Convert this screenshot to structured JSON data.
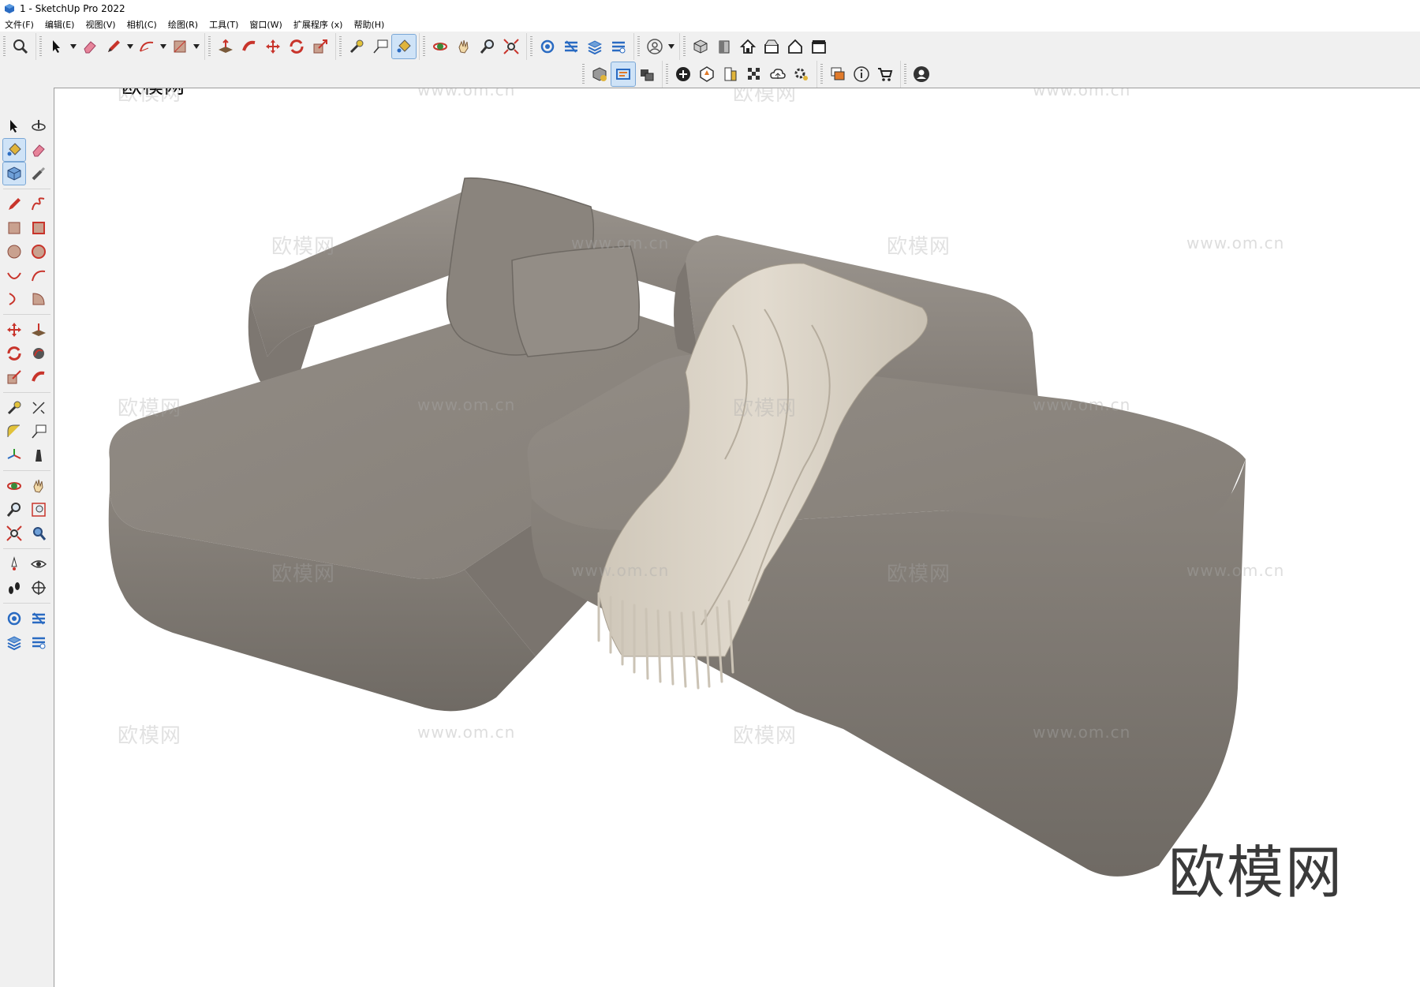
{
  "window": {
    "title": "1 - SketchUp Pro 2022",
    "app_icon": "sketchup-icon"
  },
  "menubar": {
    "items": [
      "文件(F)",
      "编辑(E)",
      "视图(V)",
      "相机(C)",
      "绘图(R)",
      "工具(T)",
      "窗口(W)",
      "扩展程序 (x)",
      "帮助(H)"
    ]
  },
  "toolbar_top": {
    "tools": [
      "zoom-icon",
      "select-icon",
      "eraser-icon",
      "pencil-icon",
      "arc-icon",
      "rectangle-icon",
      "push-pull-icon",
      "follow-me-icon",
      "move-icon",
      "rotate-icon",
      "scale-icon",
      "tape-measure-icon",
      "text-icon",
      "paint-bucket-icon",
      "orbit-icon",
      "pan-icon",
      "zoom-icon",
      "zoom-extents-icon",
      "warehouse-icon",
      "extension-icon",
      "layers-icon",
      "tags-icon",
      "user-icon",
      "iso-view-icon",
      "front-view-icon",
      "home-view-icon",
      "top-view-icon",
      "house-view-icon",
      "store-icon"
    ]
  },
  "toolbar_second": {
    "tools": [
      "solid-tools-icon",
      "outliner-icon",
      "scene-icon",
      "add-icon",
      "location-icon",
      "style-icon",
      "texture-icon",
      "cloud-icon",
      "settings-icon",
      "components-icon",
      "info-icon",
      "cart-icon",
      "account-icon"
    ]
  },
  "left_toolbar": {
    "tools": [
      "select-icon",
      "orbit-icon",
      "paint-bucket-icon",
      "eraser-icon",
      "component-icon",
      "tape-icon",
      "line-icon",
      "freehand-icon",
      "rectangle-icon",
      "rotated-rectangle-icon",
      "circle-icon",
      "polygon-icon",
      "arc-icon",
      "arc-2pt-icon",
      "arc-3pt-icon",
      "pie-icon",
      "move-icon",
      "push-pull-icon",
      "rotate-icon",
      "follow-me-icon",
      "scale-icon",
      "offset-icon",
      "tape-measure-icon",
      "dimension-icon",
      "protractor-icon",
      "text-icon",
      "axes-icon",
      "3d-text-icon",
      "orbit-icon",
      "pan-icon",
      "zoom-icon",
      "zoom-window-icon",
      "zoom-extents-icon",
      "previous-icon",
      "position-camera-icon",
      "look-around-icon",
      "walk-icon",
      "section-plane-icon",
      "warehouse-icon",
      "extension-warehouse-icon",
      "layers-icon",
      "tags-icon"
    ]
  },
  "viewport": {
    "watermark_cn": "欧模网",
    "watermark_url": "www.om.cn",
    "corner_logo": "欧模网",
    "sofa_color": "#8c867f",
    "throw_color": "#d9d2c5"
  }
}
